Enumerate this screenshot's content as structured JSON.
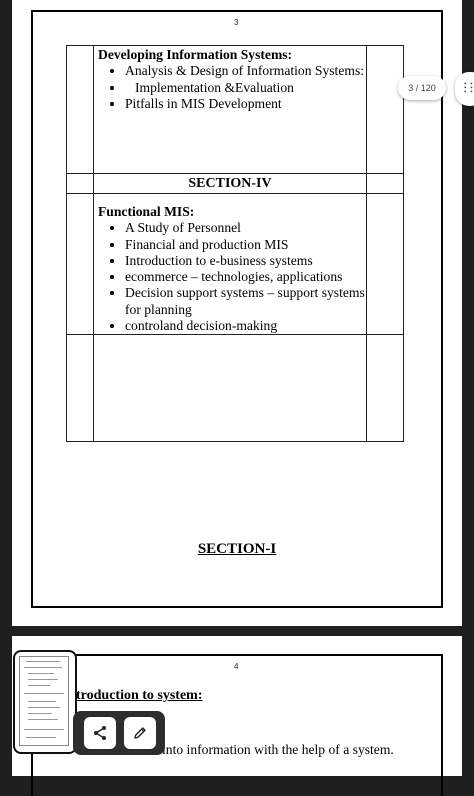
{
  "page1": {
    "number": "3",
    "table": {
      "block1": {
        "heading": "Developing Information Systems:",
        "items": [
          "Analysis & Design of Information Systems:",
          "Implementation &Evaluation",
          "Pitfalls in MIS Development"
        ]
      },
      "section_heading": "SECTION-IV",
      "block2": {
        "heading": "Functional MIS:",
        "items": [
          "A Study of Personnel",
          "Financial and production MIS",
          "Introduction to e-business systems",
          "ecommerce – technologies, applications",
          "Decision support systems – support systems for planning",
          "controland decision-making"
        ]
      }
    },
    "section_footer": "SECTION-I"
  },
  "page2": {
    "number": "4",
    "title": "troduction to system:",
    "text": "into information with the help of a system."
  },
  "viewer": {
    "page_indicator": "3 / 120",
    "tools": [
      "share-icon",
      "pencil-icon"
    ]
  }
}
